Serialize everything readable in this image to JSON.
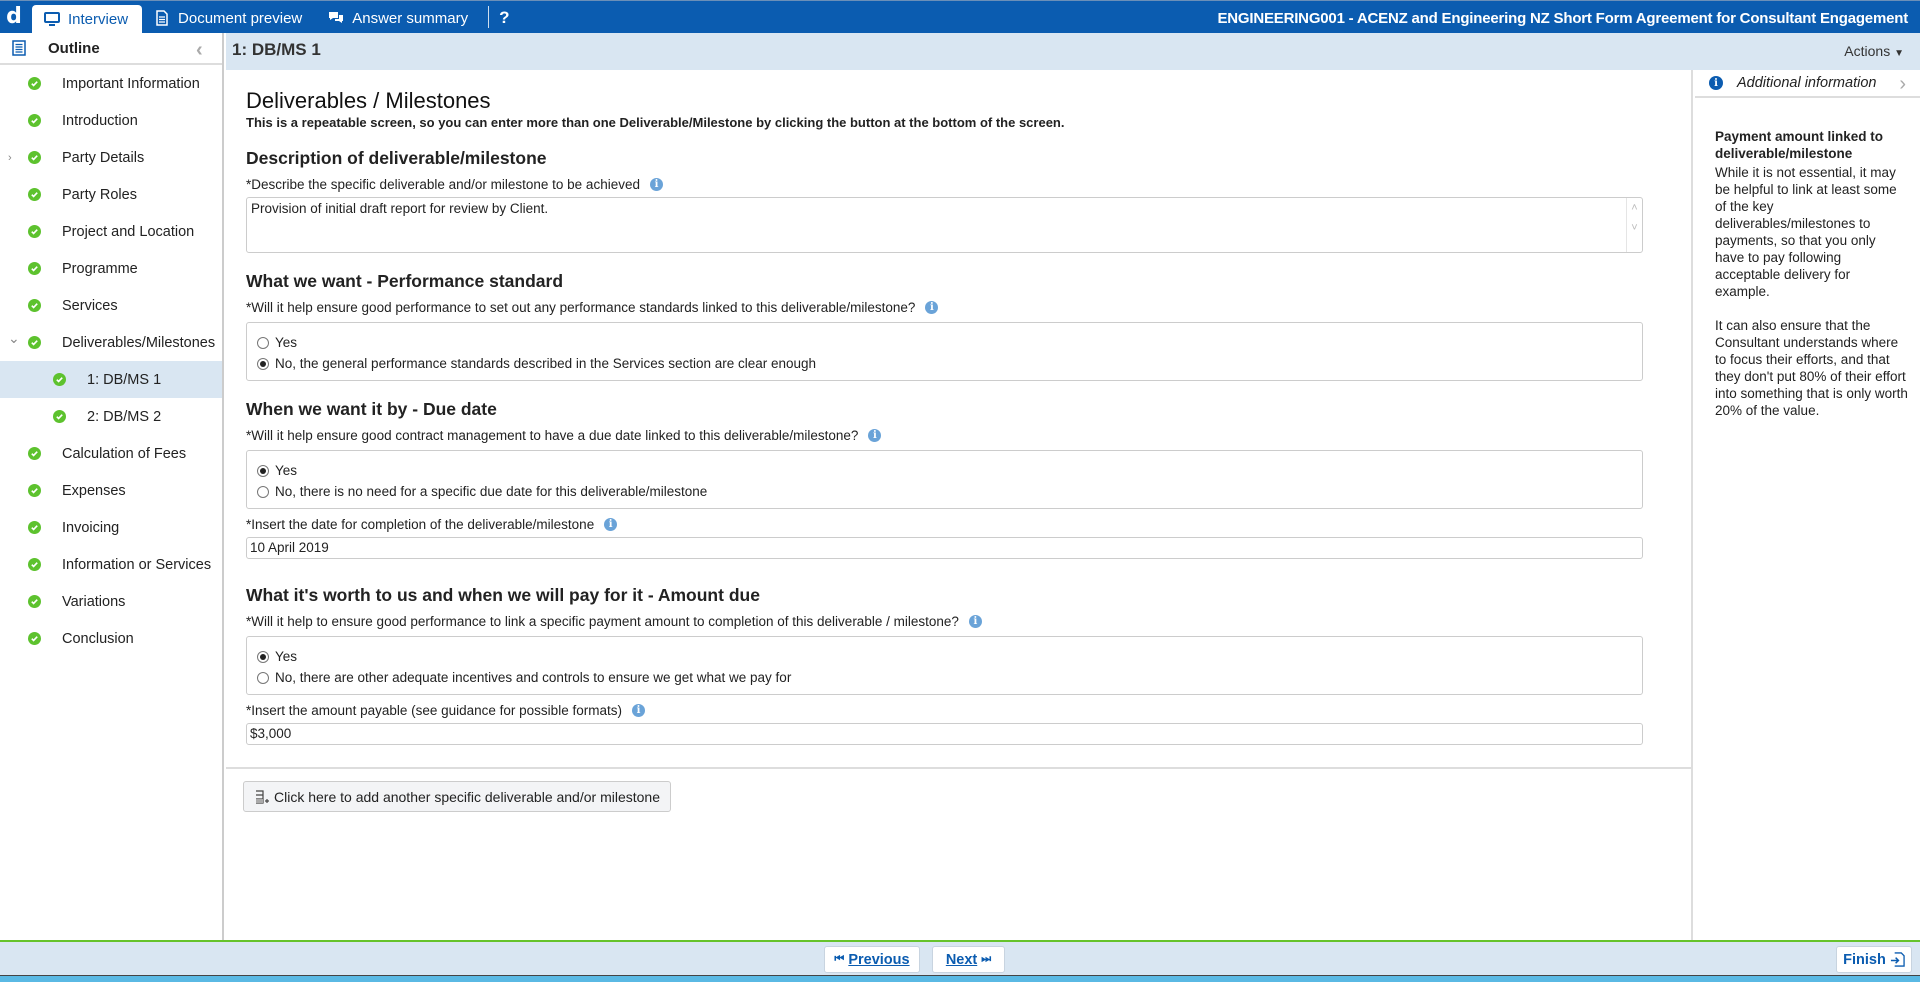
{
  "app": {
    "logo": "d",
    "tabs": [
      {
        "label": "Interview",
        "icon": "monitor-icon",
        "active": true
      },
      {
        "label": "Document preview",
        "icon": "document-icon",
        "active": false
      },
      {
        "label": "Answer summary",
        "icon": "chat-bubbles-icon",
        "active": false
      }
    ],
    "help_label": "?",
    "document_title": "ENGINEERING001 - ACENZ and Engineering NZ Short Form Agreement for Consultant Engagement"
  },
  "sidebar": {
    "title": "Outline",
    "items": [
      {
        "label": "Important Information",
        "complete": true
      },
      {
        "label": "Introduction",
        "complete": true
      },
      {
        "label": "Party Details",
        "complete": true,
        "expander": "collapsed"
      },
      {
        "label": "Party Roles",
        "complete": true
      },
      {
        "label": "Project and Location",
        "complete": true
      },
      {
        "label": "Programme",
        "complete": true
      },
      {
        "label": "Services",
        "complete": true
      },
      {
        "label": "Deliverables/Milestones",
        "complete": true,
        "expander": "expanded"
      },
      {
        "label": "1: DB/MS 1",
        "complete": true,
        "sub": true,
        "selected": true
      },
      {
        "label": "2: DB/MS 2",
        "complete": true,
        "sub": true
      },
      {
        "label": "Calculation of Fees",
        "complete": true
      },
      {
        "label": "Expenses",
        "complete": true
      },
      {
        "label": "Invoicing",
        "complete": true
      },
      {
        "label": "Information or Services",
        "complete": true
      },
      {
        "label": "Variations",
        "complete": true
      },
      {
        "label": "Conclusion",
        "complete": true
      }
    ]
  },
  "header": {
    "page_title": "1: DB/MS 1",
    "actions_label": "Actions"
  },
  "main": {
    "heading": "Deliverables / Milestones",
    "subtitle": "This is a repeatable screen, so you can enter more than one Deliverable/Milestone by clicking the button at the bottom of the screen.",
    "sections": {
      "description": {
        "heading": "Description of deliverable/milestone",
        "question": "*Describe the specific deliverable and/or milestone to be achieved",
        "value": "Provision of initial draft report for review by Client."
      },
      "performance": {
        "heading": "What we want - Performance standard",
        "question": "*Will it help ensure good performance to set out any performance standards linked to this deliverable/milestone?",
        "options": [
          "Yes",
          "No, the general performance standards described in the Services section are clear enough"
        ],
        "selected": 1
      },
      "due_date": {
        "heading": "When we want it by - Due date",
        "question": "*Will it help ensure good contract management to have a due date linked to this deliverable/milestone?",
        "options": [
          "Yes",
          "No, there is no need for a specific due date for this deliverable/milestone"
        ],
        "selected": 0,
        "date_question": "*Insert the date for completion of the deliverable/milestone",
        "date_value": "10 April 2019"
      },
      "amount": {
        "heading": "What it's worth to us and when we will pay for it - Amount due",
        "question": "*Will it help to ensure good performance to link a specific payment amount to completion of this deliverable / milestone?",
        "options": [
          "Yes",
          "No, there are other adequate incentives and controls to ensure we get what we pay for"
        ],
        "selected": 0,
        "amount_question": "*Insert the amount payable (see guidance for possible formats)",
        "amount_value": "$3,000"
      }
    },
    "add_button_label": "Click here to add another specific deliverable and/or milestone"
  },
  "right_panel": {
    "title": "Additional information",
    "guidance_title": "Payment amount linked to deliverable/milestone",
    "paragraphs": [
      "While it is not essential, it may be helpful to link at least some of the key deliverables/milestones to payments, so that you only have to pay following acceptable delivery for example.",
      "It can also ensure that the Consultant understands where to focus their efforts, and that they don't put 80% of their effort into something that is only worth 20% of the value."
    ]
  },
  "footer": {
    "previous_label": "Previous",
    "next_label": "Next",
    "finish_label": "Finish"
  },
  "colors": {
    "brand_blue": "#0b5cb0",
    "header_bg": "#d9e6f2",
    "complete_green": "#5dc22e",
    "footer_accent": "#66c32c"
  }
}
